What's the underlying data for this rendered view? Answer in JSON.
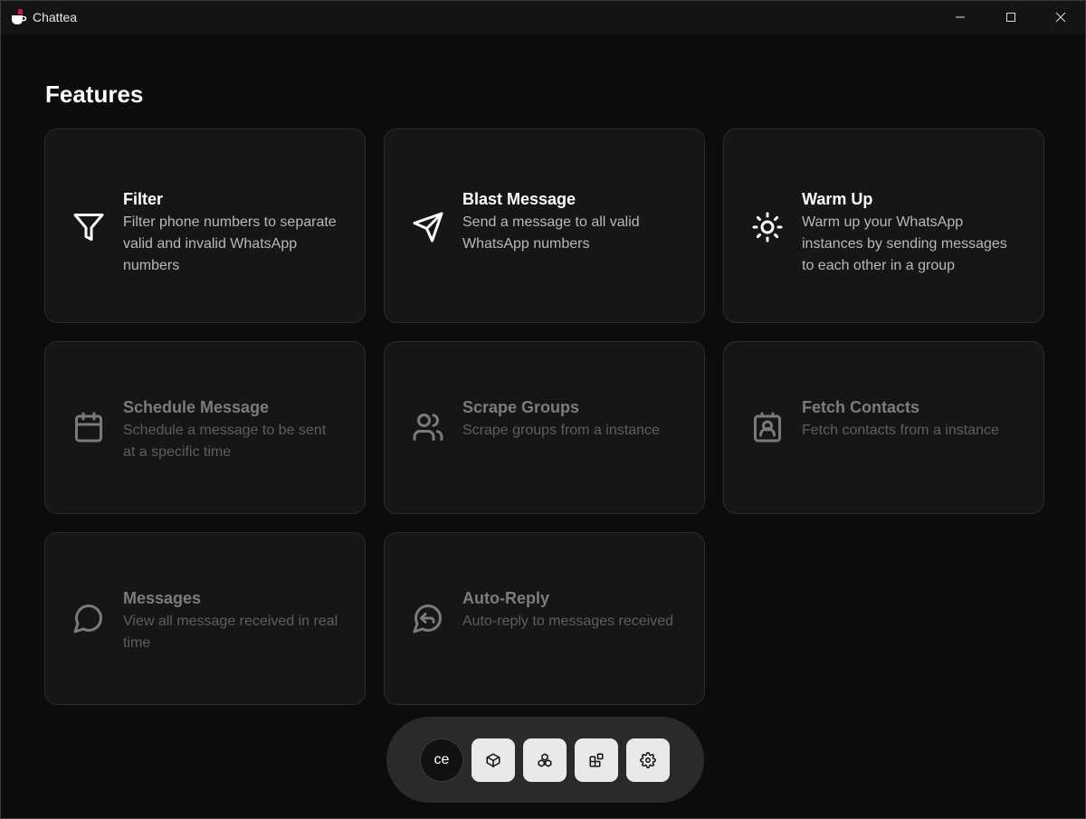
{
  "window": {
    "title": "Chattea",
    "controls": [
      "minimize-icon",
      "maximize-icon",
      "close-icon"
    ]
  },
  "page": {
    "heading": "Features"
  },
  "features": [
    {
      "title": "Filter",
      "description": "Filter phone numbers to separate valid and invalid WhatsApp numbers",
      "icon": "filter-icon",
      "enabled": true
    },
    {
      "title": "Blast Message",
      "description": "Send a message to all valid WhatsApp numbers",
      "icon": "send-icon",
      "enabled": true
    },
    {
      "title": "Warm Up",
      "description": "Warm up your WhatsApp instances by sending messages to each other in a group",
      "icon": "sun-icon",
      "enabled": true
    },
    {
      "title": "Schedule Message",
      "description": "Schedule a message to be sent at a specific time",
      "icon": "calendar-icon",
      "enabled": false
    },
    {
      "title": "Scrape Groups",
      "description": "Scrape groups from a instance",
      "icon": "users-icon",
      "enabled": false
    },
    {
      "title": "Fetch Contacts",
      "description": "Fetch contacts from a instance",
      "icon": "contact-icon",
      "enabled": false
    },
    {
      "title": "Messages",
      "description": "View all message received in real time",
      "icon": "message-circle-icon",
      "enabled": false
    },
    {
      "title": "Auto-Reply",
      "description": "Auto-reply to messages received",
      "icon": "message-reply-icon",
      "enabled": false
    }
  ],
  "dock": {
    "avatar_initials": "ce",
    "buttons": [
      "box-icon",
      "boxes-icon",
      "blocks-icon",
      "settings-gear-icon"
    ]
  },
  "colors": {
    "background": "#0c0c0c",
    "card": "#161616",
    "card_border": "#2b2b2b",
    "dock": "#2a2a2a",
    "dock_button": "#e9e9e9",
    "brand": "#c2185b"
  }
}
